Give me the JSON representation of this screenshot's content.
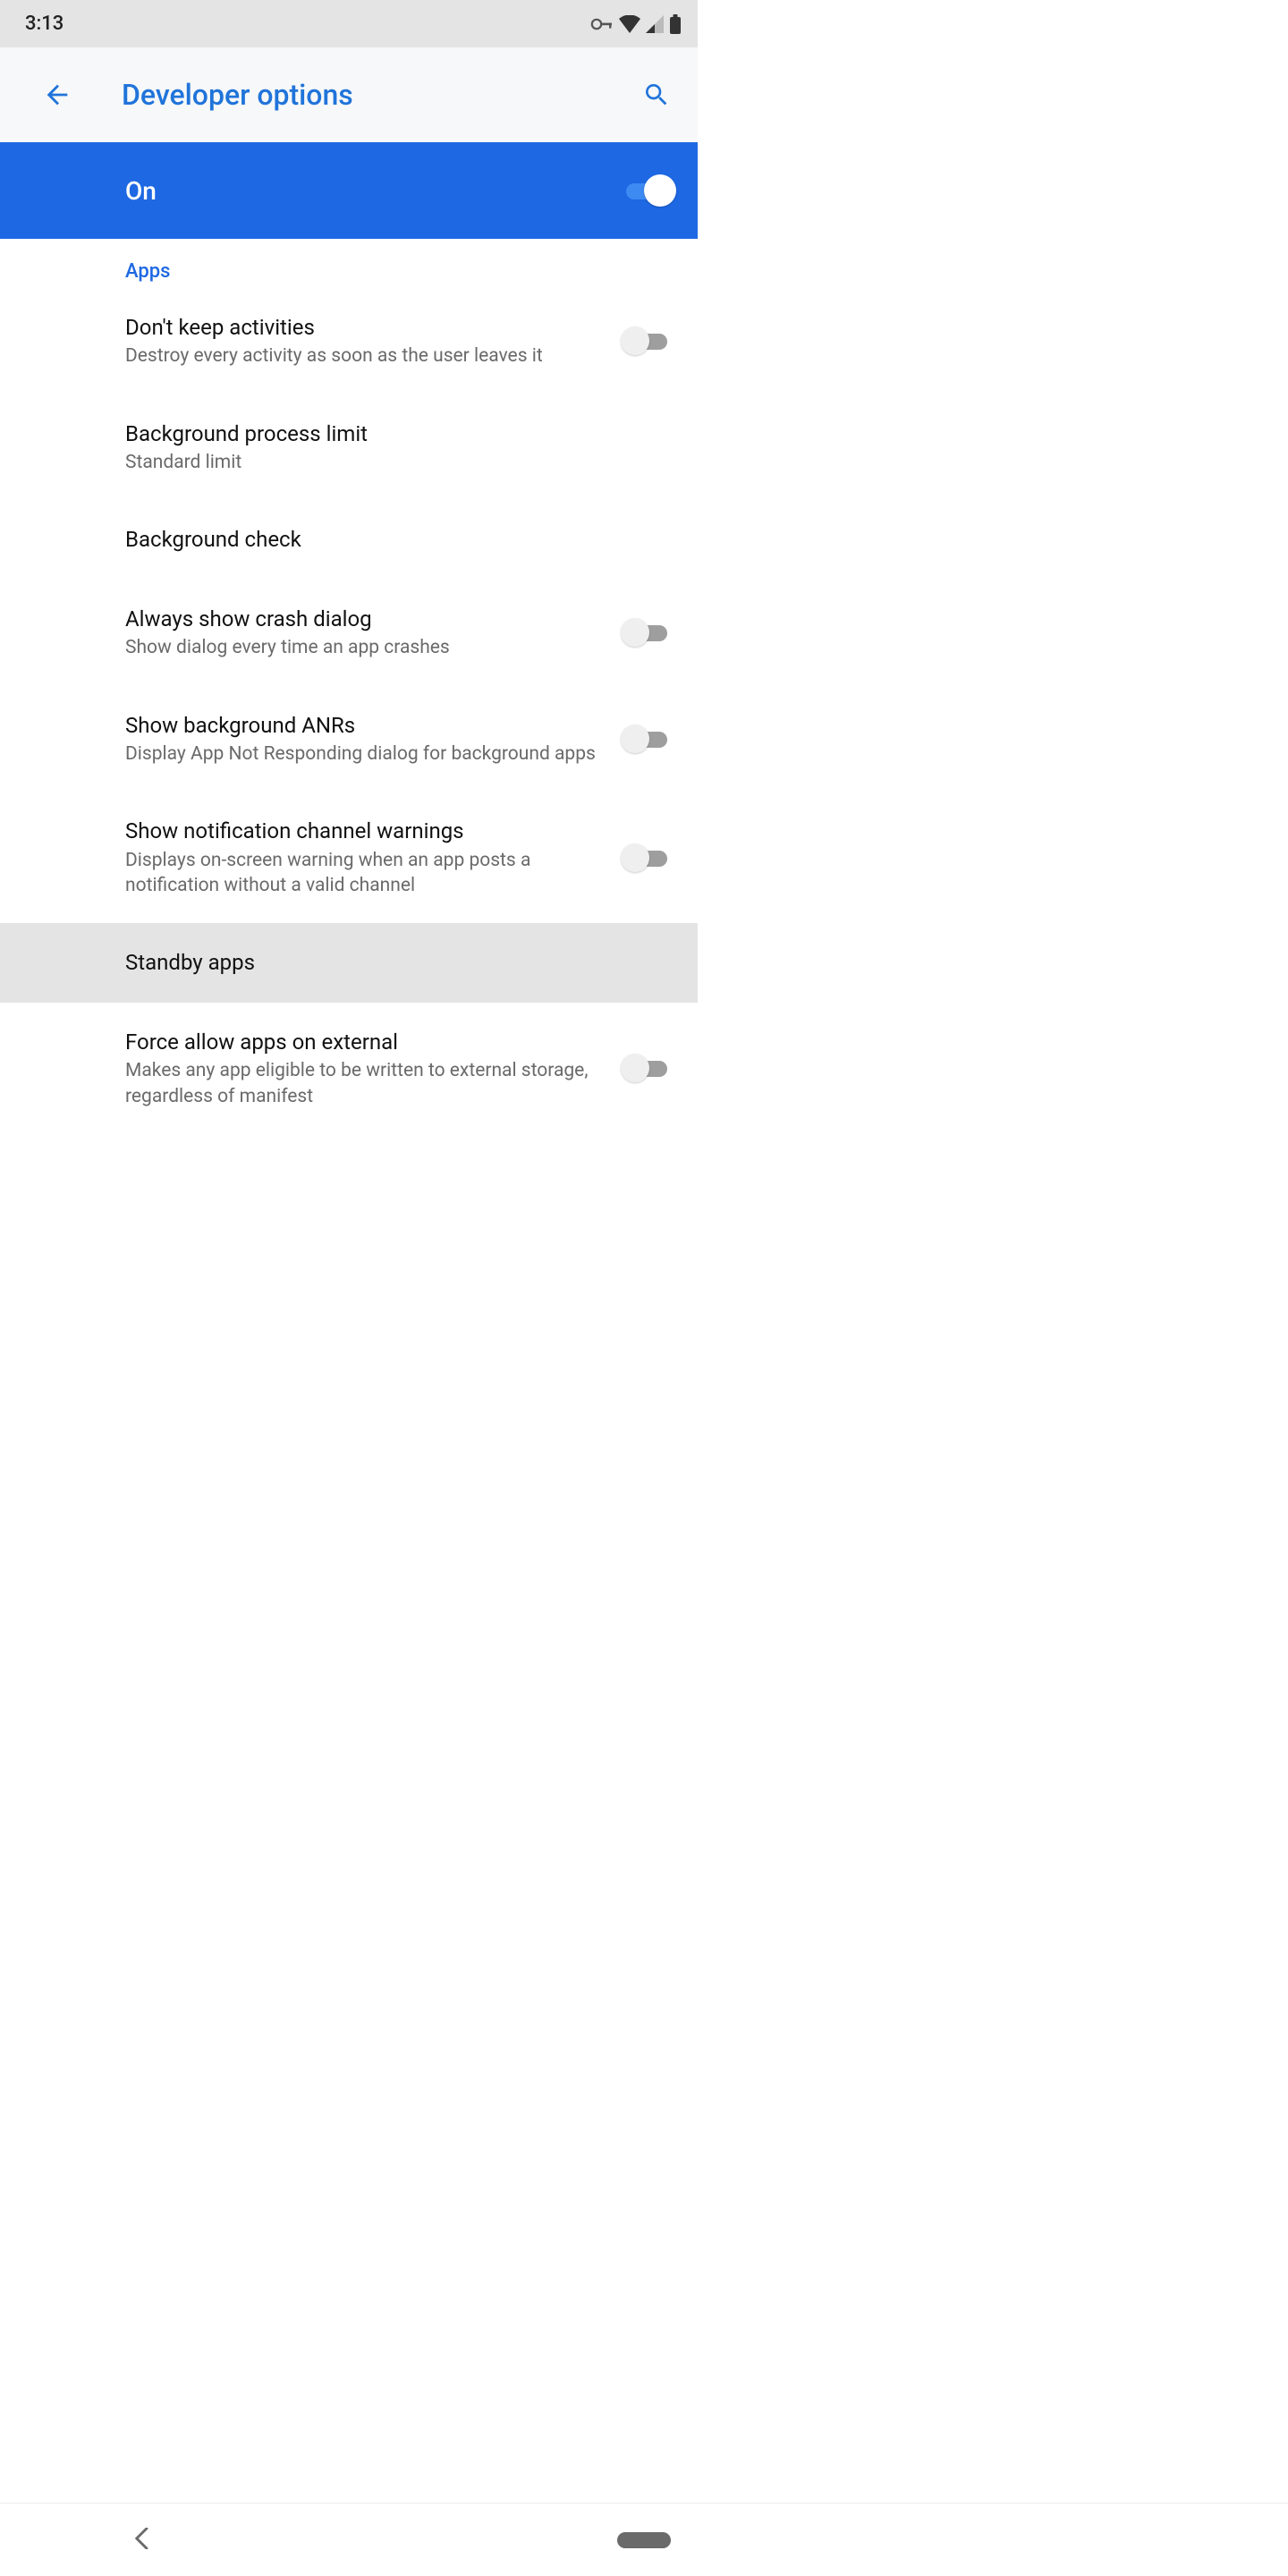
{
  "statusbar": {
    "time": "3:13"
  },
  "appbar": {
    "title": "Developer options"
  },
  "master": {
    "label": "On",
    "on": true
  },
  "section": {
    "label": "Apps"
  },
  "rows": [
    {
      "title": "Don't keep activities",
      "sub": "Destroy every activity as soon as the user leaves it",
      "toggle": false
    },
    {
      "title": "Background process limit",
      "sub": "Standard limit"
    },
    {
      "title": "Background check"
    },
    {
      "title": "Always show crash dialog",
      "sub": "Show dialog every time an app crashes",
      "toggle": false
    },
    {
      "title": "Show background ANRs",
      "sub": "Display App Not Responding dialog for background apps",
      "toggle": false
    },
    {
      "title": "Show notification channel warnings",
      "sub": "Displays on-screen warning when an app posts a notification without a valid channel",
      "toggle": false
    },
    {
      "title": "Standby apps",
      "disabled": true
    },
    {
      "title": "Force allow apps on external",
      "sub": "Makes any app eligible to be written to external storage, regardless of manifest",
      "toggle": false
    }
  ]
}
